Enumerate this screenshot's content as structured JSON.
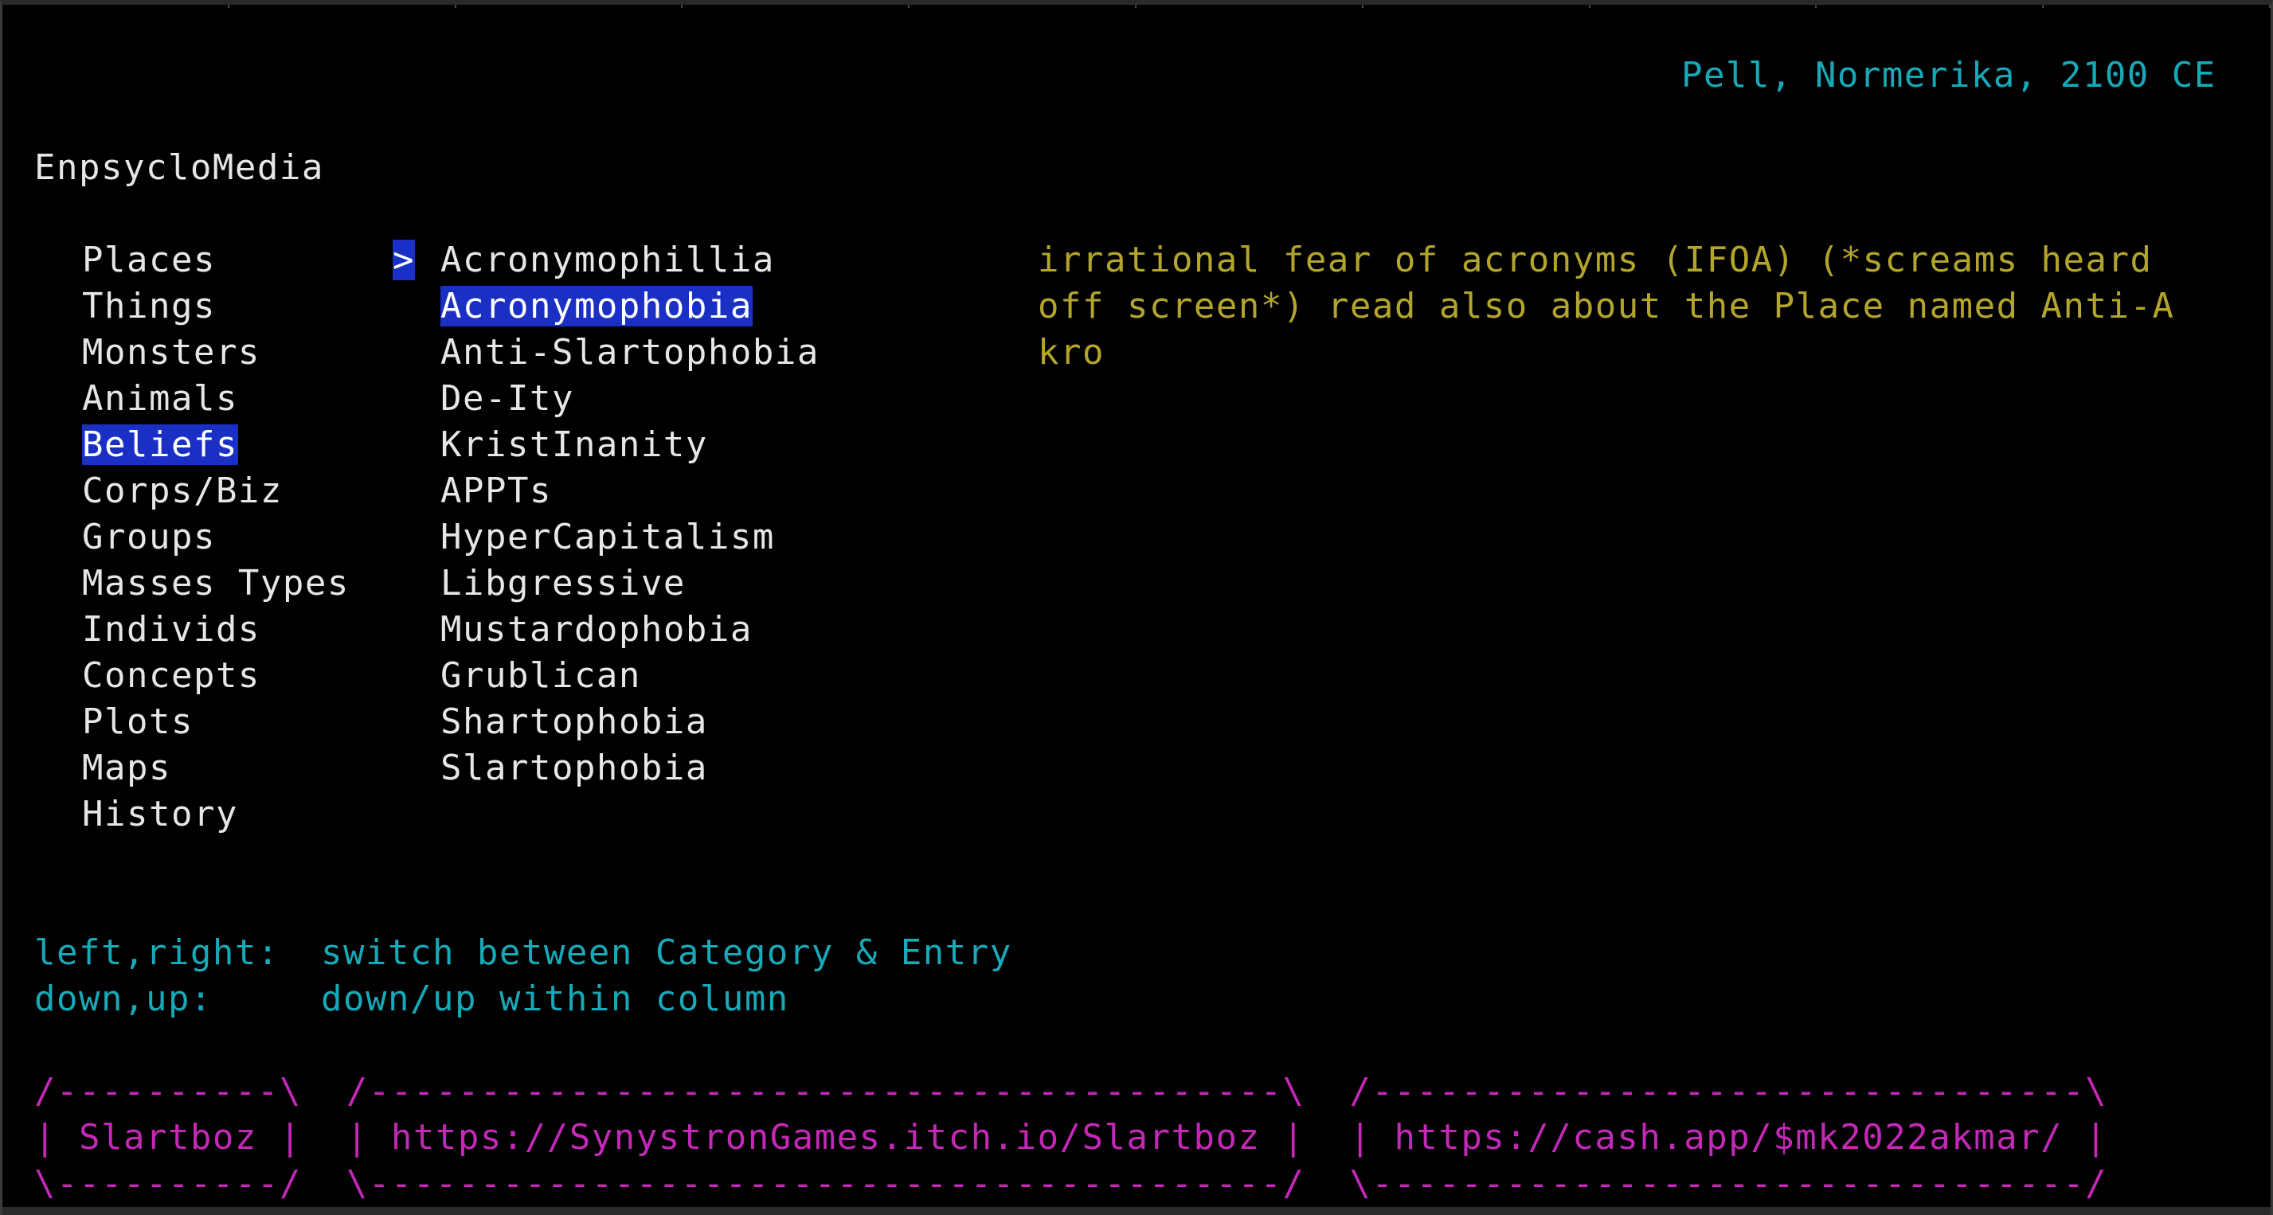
{
  "header": {
    "location": "Pell, Normerika, 2100 CE",
    "app_title": "EnpsycloMedia"
  },
  "categories": [
    {
      "label": "Places"
    },
    {
      "label": "Things"
    },
    {
      "label": "Monsters"
    },
    {
      "label": "Animals"
    },
    {
      "label": "Beliefs",
      "selected": true
    },
    {
      "label": "Corps/Biz"
    },
    {
      "label": "Groups"
    },
    {
      "label": "Masses Types"
    },
    {
      "label": "Individs"
    },
    {
      "label": "Concepts"
    },
    {
      "label": "Plots"
    },
    {
      "label": "Maps"
    },
    {
      "label": "History"
    }
  ],
  "cursor_glyph": ">",
  "entries": [
    {
      "label": "Acronymophillia"
    },
    {
      "label": "Acronymophobia",
      "selected": true
    },
    {
      "label": "Anti-Slartophobia"
    },
    {
      "label": "De-Ity"
    },
    {
      "label": "KristInanity"
    },
    {
      "label": "APPTs"
    },
    {
      "label": "HyperCapitalism"
    },
    {
      "label": "Libgressive"
    },
    {
      "label": "Mustardophobia"
    },
    {
      "label": "Grublican"
    },
    {
      "label": "Shartophobia"
    },
    {
      "label": "Slartophobia"
    }
  ],
  "description": {
    "lines": [
      "irrational fear of acronyms (IFOA) (*screams heard",
      "off screen*) read also about the Place named Anti-A",
      "kro"
    ]
  },
  "help": {
    "line1_key": "left,right:",
    "line1_text": "switch between Category & Entry",
    "line2_key": "down,up:",
    "line2_text": "down/up within column"
  },
  "footer_boxes": {
    "top_line": "/----------\\  /-----------------------------------------\\  /--------------------------------\\",
    "middle_line": "| Slartboz |  | https://SynystronGames.itch.io/Slartboz |  | https://cash.app/$mk2022akmar/ |",
    "bottom_line": "\\----------/  \\-----------------------------------------/  \\--------------------------------/",
    "box1_label": "Slartboz",
    "box2_label": "https://SynystronGames.itch.io/Slartboz",
    "box3_label": "https://cash.app/$mk2022akmar/"
  },
  "colors": {
    "background": "#000000",
    "text": "#e6e6e6",
    "cyan": "#17a9b8",
    "olive": "#b3a52c",
    "magenta": "#c328b6",
    "selection": "#1a2fc4"
  }
}
